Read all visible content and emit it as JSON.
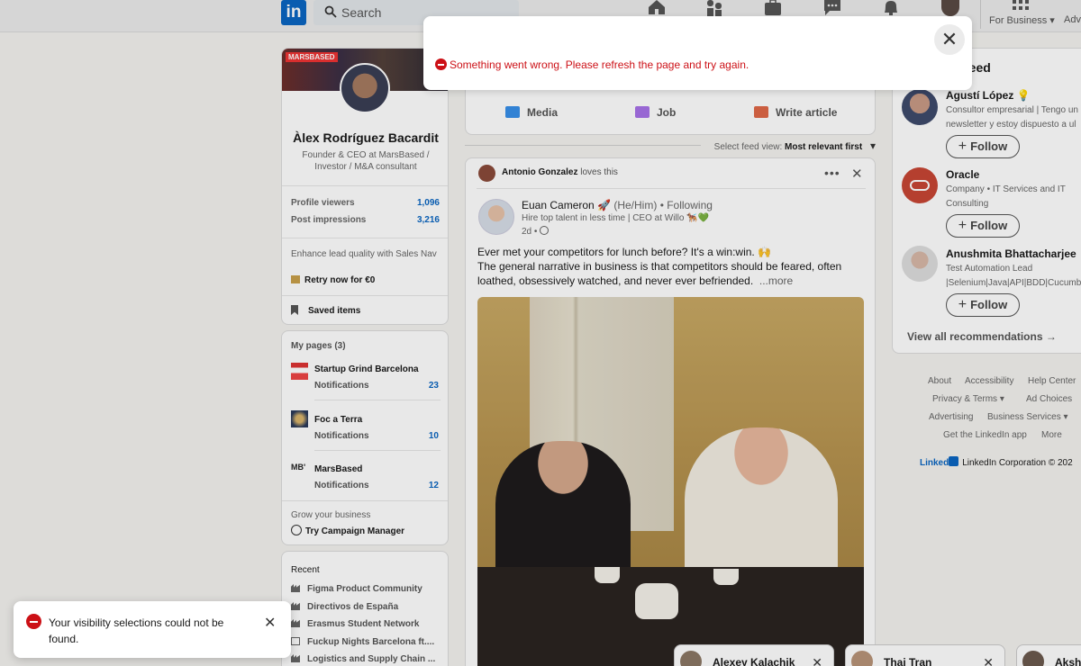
{
  "nav": {
    "logo": "in",
    "search_placeholder": "Search",
    "for_business": "For Business",
    "advertise": "Adv"
  },
  "profile": {
    "cover_tag": "MARSBASED",
    "name": "Àlex Rodríguez Bacardit",
    "headline": "Founder & CEO at MarsBased / Investor / M&A consultant",
    "stats": [
      {
        "label": "Profile viewers",
        "value": "1,096"
      },
      {
        "label": "Post impressions",
        "value": "3,216"
      }
    ],
    "promo_text": "Enhance lead quality with Sales Nav",
    "promo_cta": "Retry now for €0",
    "saved_items": "Saved items"
  },
  "my_pages": {
    "title": "My pages (3)",
    "pages": [
      {
        "name": "Startup Grind Barcelona",
        "notif_label": "Notifications",
        "count": "23"
      },
      {
        "name": "Foc a Terra",
        "notif_label": "Notifications",
        "count": "10"
      },
      {
        "name": "MarsBased",
        "notif_label": "Notifications",
        "count": "12"
      }
    ],
    "grow_label": "Grow your business",
    "campaign_cta": "Try Campaign Manager"
  },
  "recent": {
    "title": "Recent",
    "items": [
      "Figma Product Community",
      "Directivos de España",
      "Erasmus Student Network",
      "Fuckup Nights Barcelona ft....",
      "Logistics and Supply Chain ..."
    ]
  },
  "share": {
    "media": "Media",
    "job": "Job",
    "write_article": "Write article"
  },
  "feed_sort": {
    "label": "Select feed view:",
    "value": "Most relevant first"
  },
  "post": {
    "context_name": "Antonio Gonzalez",
    "context_action": "loves this",
    "author": "Euan Cameron 🚀",
    "pronouns": "(He/Him)",
    "following": "• Following",
    "subtitle": "Hire top talent in less time | CEO at Willo 🐕‍🦺💚",
    "time": "2d •",
    "text_line1": "Ever met your competitors for lunch before? It's a win:win. 🙌",
    "text_line2": "The general narrative in business is that competitors should be feared, often loathed, obsessively watched, and never ever befriended.",
    "more": "...more"
  },
  "recommendations": {
    "title": "feed",
    "items": [
      {
        "name": "Agustí López 💡",
        "desc1": "Consultor empresarial | Tengo un",
        "desc2": "newsletter y estoy dispuesto a ul",
        "follow": "Follow"
      },
      {
        "name": "Oracle",
        "desc1": "Company • IT Services and IT",
        "desc2": "Consulting",
        "follow": "Follow"
      },
      {
        "name": "Anushmita Bhattacharjee",
        "desc1": "Test Automation Lead",
        "desc2": "|Selenium|Java|API|BDD|Cucumb",
        "follow": "Follow"
      }
    ],
    "view_all": "View all recommendations →"
  },
  "footer": {
    "about": "About",
    "accessibility": "Accessibility",
    "help": "Help Center",
    "privacy": "Privacy & Terms",
    "ad_choices": "Ad Choices",
    "advertising": "Advertising",
    "business_services": "Business Services",
    "get_app": "Get the LinkedIn app",
    "more": "More",
    "brand": "Linked",
    "copyright": "LinkedIn Corporation © 202"
  },
  "chats": [
    "Alexey Kalachik",
    "Thai Tran",
    "Aksh"
  ],
  "modal": {
    "error": "Something went wrong. Please refresh the page and try again.",
    "close": "✕"
  },
  "toast": {
    "message": "Your visibility selections could not be found.",
    "close": "✕"
  }
}
